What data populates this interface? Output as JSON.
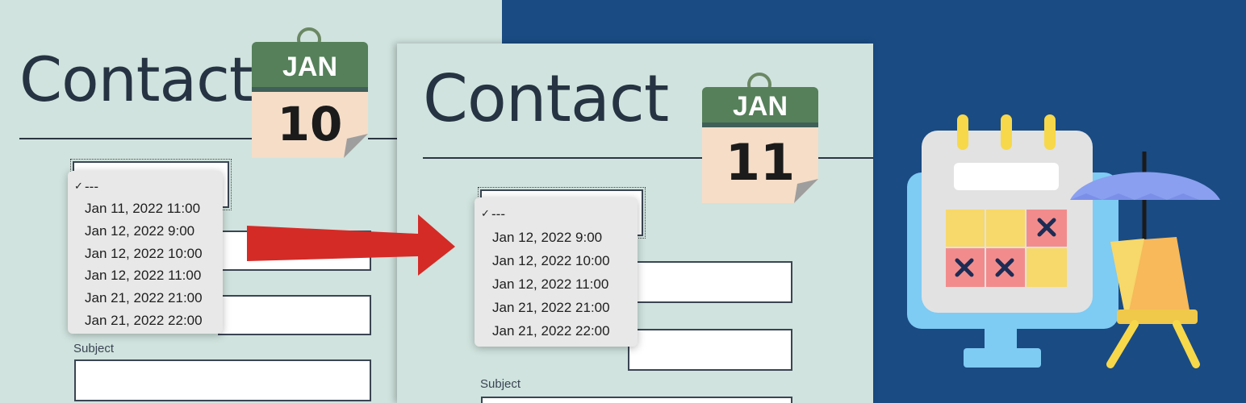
{
  "before": {
    "title": "Contact",
    "calendar": {
      "month": "JAN",
      "day": "10"
    },
    "dropdown": {
      "selected": "---",
      "options": [
        "---",
        "Jan 11, 2022 11:00",
        "Jan 12, 2022 9:00",
        "Jan 12, 2022 10:00",
        "Jan 12, 2022 11:00",
        "Jan 21, 2022 21:00",
        "Jan 21, 2022 22:00"
      ]
    },
    "subject_label": "Subject"
  },
  "after": {
    "title": "Contact",
    "calendar": {
      "month": "JAN",
      "day": "11"
    },
    "dropdown": {
      "selected": "---",
      "options": [
        "---",
        "Jan 12, 2022 9:00",
        "Jan 12, 2022 10:00",
        "Jan 12, 2022 11:00",
        "Jan 21, 2022 21:00",
        "Jan 21, 2022 22:00"
      ]
    },
    "subject_label": "Subject"
  },
  "colors": {
    "background": "#1a4b83",
    "panel": "#d0e3de",
    "arrow": "#d42b27",
    "calendar_header": "#55805a",
    "calendar_body": "#f5ddc8"
  },
  "icons": [
    "calendar-icon",
    "arrow-right-icon",
    "schedule-monitor-icon",
    "beach-umbrella-icon",
    "beach-chair-icon"
  ]
}
